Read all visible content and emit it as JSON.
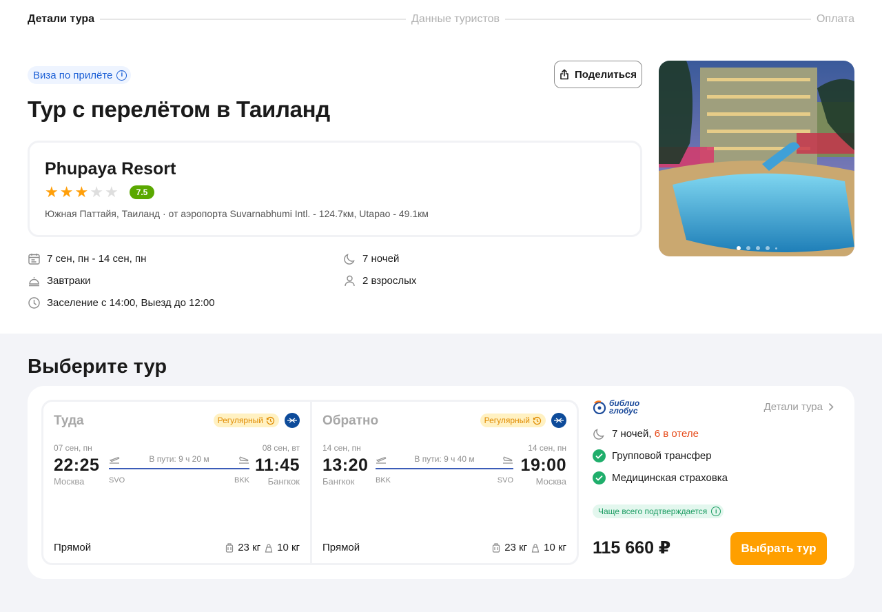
{
  "stepper": {
    "steps": [
      {
        "label": "Детали тура",
        "state": "active"
      },
      {
        "label": "Данные туристов",
        "state": "inactive"
      },
      {
        "label": "Оплата",
        "state": "inactive"
      }
    ]
  },
  "visa_badge": "Виза по прилёте",
  "share_label": "Поделиться",
  "page_title": "Тур с перелётом в Таиланд",
  "hotel": {
    "name": "Phupaya Resort",
    "stars": 3,
    "stars_max": 5,
    "score": "7.5",
    "address": "Южная Паттайя, Таиланд · от аэропорта Suvarnabhumi Intl. - 124.7км, Utapao - 49.1км"
  },
  "features": {
    "dates": "7 сен, пн - 14 сен, пн",
    "nights": "7 ночей",
    "meals": "Завтраки",
    "guests": "2 взрослых",
    "checkin": "Заселение с 14:00, Выезд до 12:00"
  },
  "gallery": {
    "dot_count": 5,
    "active_index": 0
  },
  "choose_title": "Выберите тур",
  "flights": [
    {
      "direction": "Туда",
      "badge": "Регулярный",
      "dep_date": "07 сен, пн",
      "dep_time": "22:25",
      "dep_city": "Москва",
      "dep_iata": "SVO",
      "arr_date": "08 сен, вт",
      "arr_time": "11:45",
      "arr_city": "Бангкок",
      "arr_iata": "BKK",
      "duration": "В пути: 9 ч 20 м",
      "type": "Прямой",
      "baggage": "23 кг",
      "hand_luggage": "10 кг"
    },
    {
      "direction": "Обратно",
      "badge": "Регулярный",
      "dep_date": "14 сен, пн",
      "dep_time": "13:20",
      "dep_city": "Бангкок",
      "dep_iata": "BKK",
      "arr_date": "14 сен, пн",
      "arr_time": "19:00",
      "arr_city": "Москва",
      "arr_iata": "SVO",
      "duration": "В пути: 9 ч 40 м",
      "type": "Прямой",
      "baggage": "23 кг",
      "hand_luggage": "10 кг"
    }
  ],
  "offer": {
    "operator": "Библио Глобус",
    "operator_line1": "библио",
    "operator_line2": "глобус",
    "details_link": "Детали тура",
    "nights": "7 ночей,",
    "nights_highlight": "6 в отеле",
    "transfer": "Групповой трансфер",
    "insurance": "Медицинская страховка",
    "confirm_badge": "Чаще всего подтверждается",
    "price": "115 660 ₽",
    "select_label": "Выбрать тур"
  },
  "colors": {
    "accent": "#ff9f00",
    "star": "#ff9f0a",
    "score_bg": "#5aa800",
    "link_blue": "#1b5fd6",
    "route_line": "#3c5cb8",
    "check_green": "#1fae6b",
    "highlight_red": "#e64a19"
  }
}
